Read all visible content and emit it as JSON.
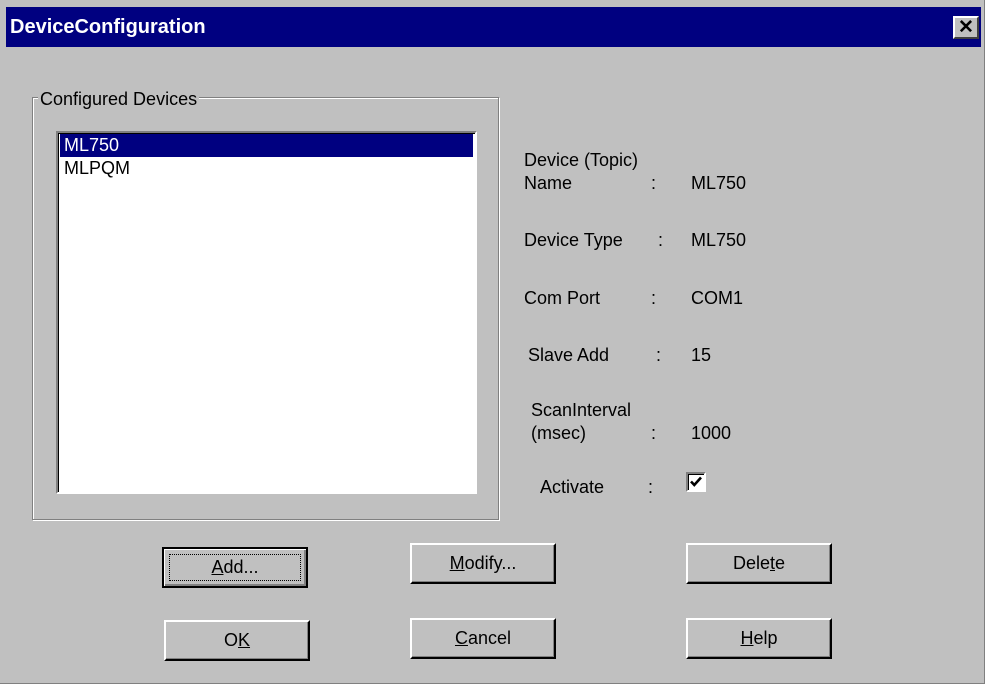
{
  "window": {
    "title": "DeviceConfiguration",
    "close_glyph": "✕",
    "close_icon": "close-icon"
  },
  "configured_devices": {
    "legend": "Configured Devices",
    "items": [
      {
        "label": "ML750",
        "selected": true
      },
      {
        "label": "MLPQM",
        "selected": false
      }
    ]
  },
  "details": {
    "name_label_line1": "Device (Topic)",
    "name_label_line2": "Name",
    "name_value": "ML750",
    "type_label": "Device Type",
    "type_value": "ML750",
    "port_label": "Com Port",
    "port_value": "COM1",
    "slave_label": "Slave Add",
    "slave_value": "15",
    "scan_label_line1": "ScanInterval",
    "scan_label_line2": "(msec)",
    "scan_value": "1000",
    "activate_label": "Activate",
    "activate_checked": true,
    "separator": ":"
  },
  "buttons": {
    "add": {
      "mnemonic": "A",
      "rest": "dd..."
    },
    "modify": {
      "mnemonic": "M",
      "rest": "odify..."
    },
    "delete": {
      "before": "Dele",
      "mnemonic": "t",
      "after": "e"
    },
    "ok": {
      "before": "O",
      "mnemonic": "K"
    },
    "cancel": {
      "mnemonic": "C",
      "rest": "ancel"
    },
    "help": {
      "mnemonic": "H",
      "rest": "elp"
    }
  },
  "colors": {
    "title_bar": "#000080",
    "dialog_face": "#c0c0c0",
    "selection": "#000080"
  }
}
